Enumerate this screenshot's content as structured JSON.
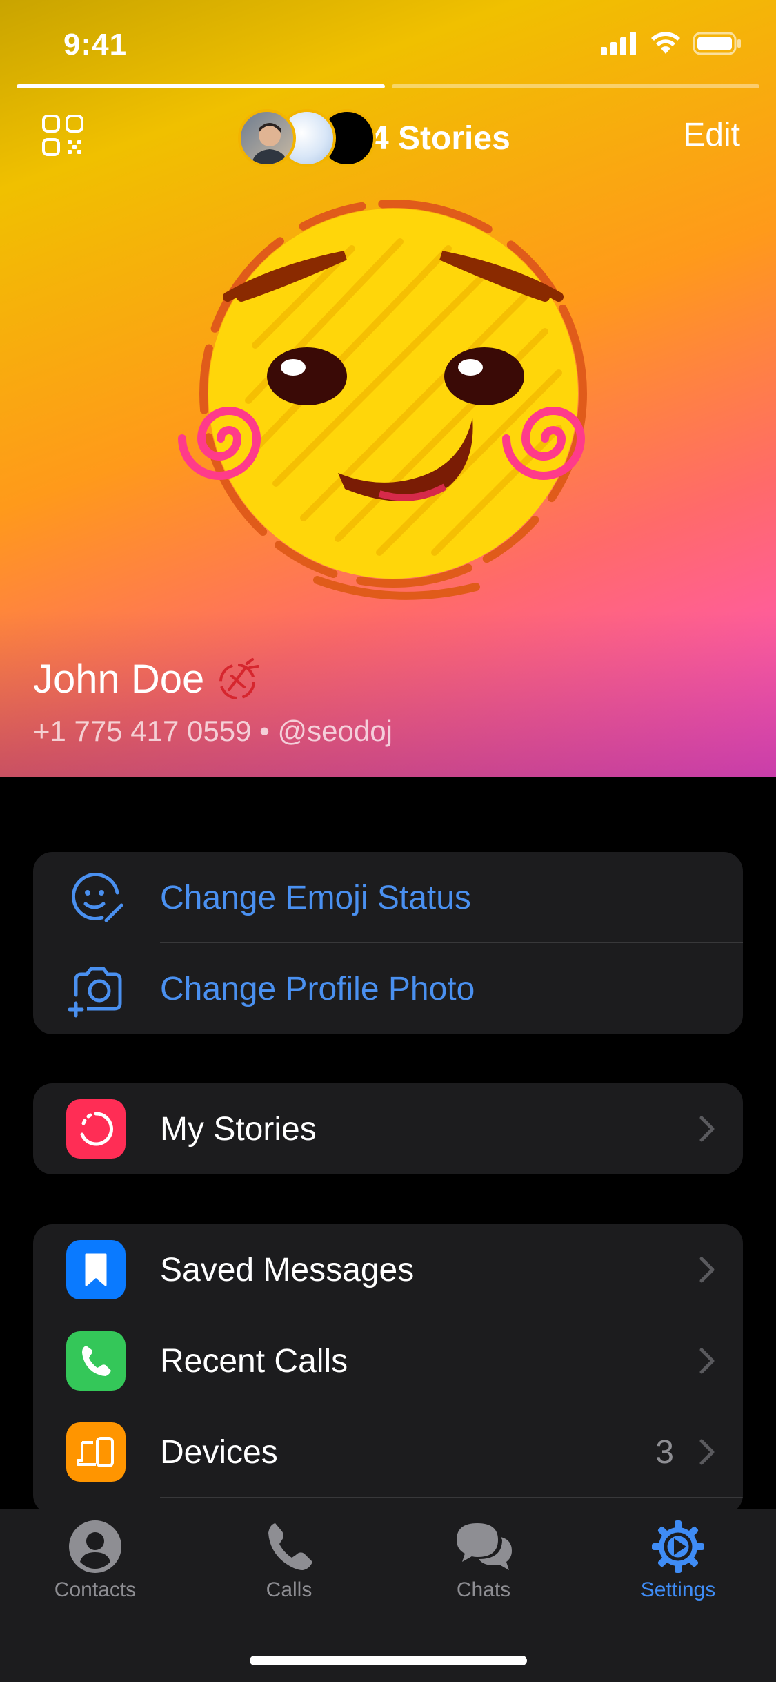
{
  "status_bar": {
    "time": "9:41"
  },
  "header": {
    "stories_label": "4 Stories",
    "edit_label": "Edit"
  },
  "profile": {
    "name": "John Doe",
    "phone_username": "+1 775 417 0559 • @seodoj"
  },
  "actions": [
    {
      "label": "Change Emoji Status",
      "icon": "emoji-status-icon"
    },
    {
      "label": "Change Profile Photo",
      "icon": "camera-add-icon"
    }
  ],
  "stories_group": {
    "label": "My Stories",
    "icon": "stories-icon",
    "color": "#ff2d55"
  },
  "menu": [
    {
      "label": "Saved Messages",
      "icon": "bookmark-icon",
      "color": "#0a7aff"
    },
    {
      "label": "Recent Calls",
      "icon": "phone-icon",
      "color": "#34c759"
    },
    {
      "label": "Devices",
      "icon": "devices-icon",
      "color": "#ff9500",
      "value": "3"
    }
  ],
  "tabs": [
    {
      "label": "Contacts",
      "icon": "person-icon"
    },
    {
      "label": "Calls",
      "icon": "phone-icon"
    },
    {
      "label": "Chats",
      "icon": "chat-bubbles-icon"
    },
    {
      "label": "Settings",
      "icon": "gear-icon",
      "active": true
    }
  ],
  "colors": {
    "accent": "#3f8cf5",
    "background": "#000000",
    "cell": "#1c1c1e"
  }
}
